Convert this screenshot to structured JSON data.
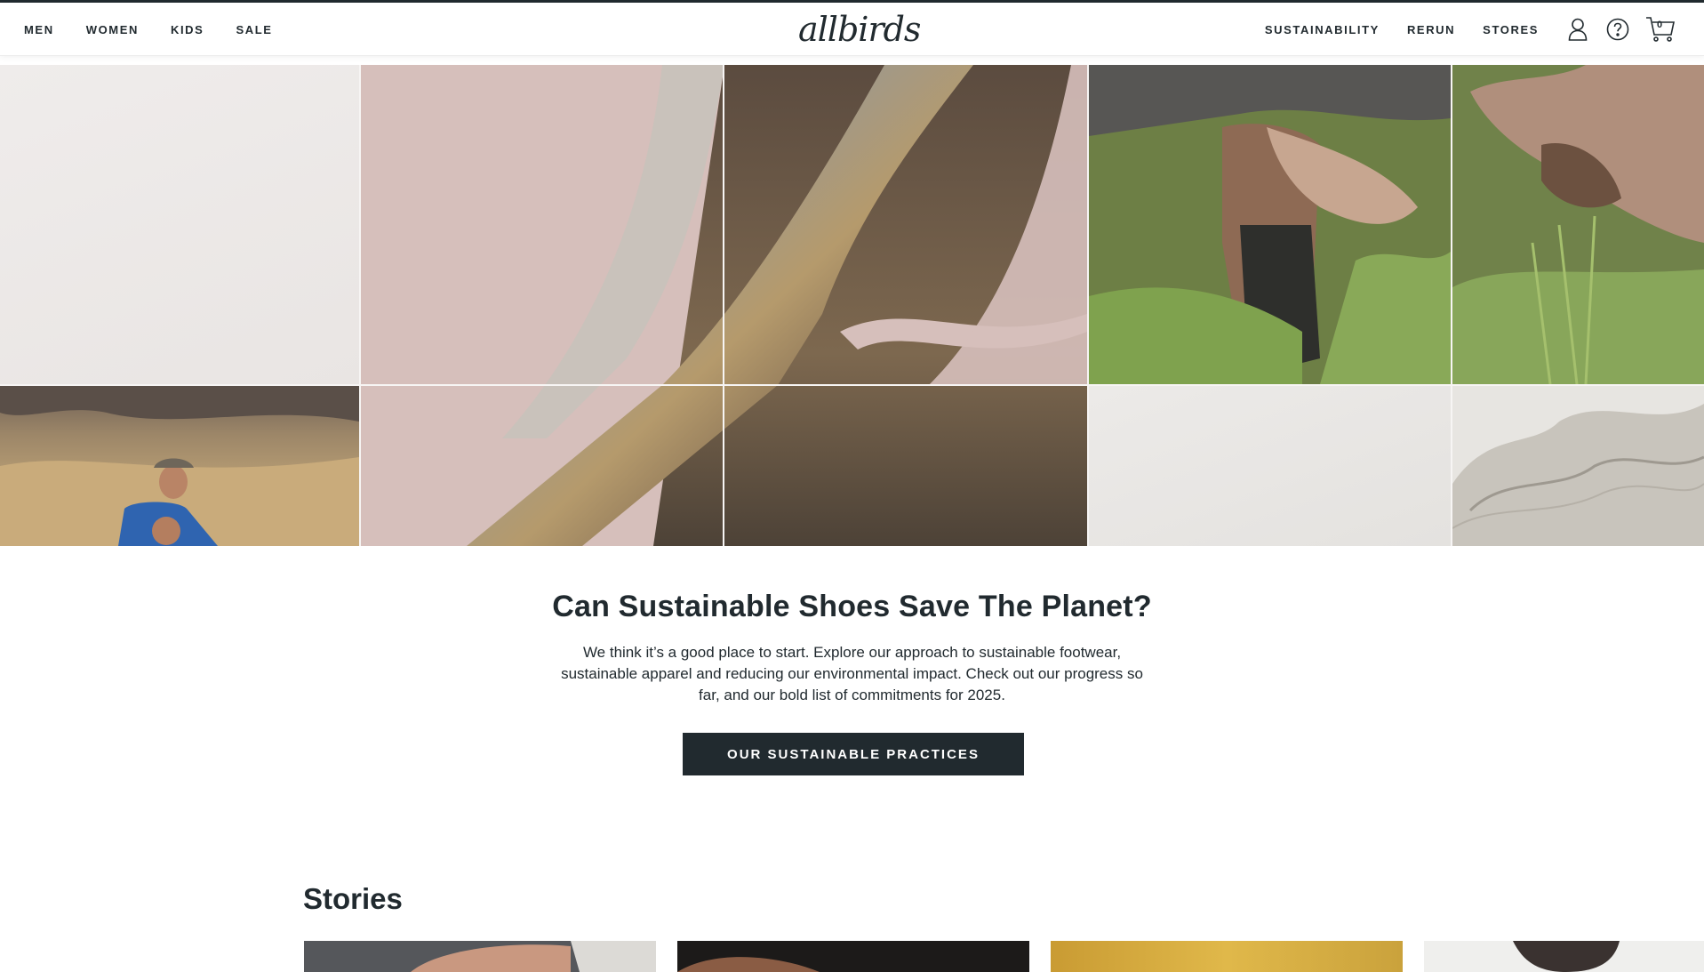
{
  "nav": {
    "left": [
      "MEN",
      "WOMEN",
      "KIDS",
      "SALE"
    ],
    "right": [
      "SUSTAINABILITY",
      "RERUN",
      "STORES"
    ],
    "logo": "allbirds",
    "cart_count": "0",
    "icons": [
      "user-icon",
      "help-icon",
      "cart-icon"
    ]
  },
  "hero": {
    "tiles": [
      "blank-tile",
      "eucalyptus-wood-tile",
      "wood-grain-tile",
      "hands-soil-tile",
      "hands-grass-tile",
      "shepherd-tile",
      "wood-lower-tile",
      "wood-dark-tile",
      "blank-tile",
      "wool-tile"
    ]
  },
  "intro": {
    "headline": "Can Sustainable Shoes Save The Planet?",
    "body": "We think it’s a good place to start. Explore our approach to sustainable footwear, sustainable apparel and reducing our environmental impact. Check out our progress so far, and our bold list of commitments for 2025.",
    "cta": "OUR SUSTAINABLE PRACTICES"
  },
  "stories": {
    "title": "Stories",
    "cards": [
      "story-card-shoes",
      "story-card-dark",
      "story-card-yellow",
      "story-card-person"
    ]
  },
  "colors": {
    "ink": "#212a2f",
    "blush": "#d6bfbb",
    "white": "#ffffff"
  }
}
